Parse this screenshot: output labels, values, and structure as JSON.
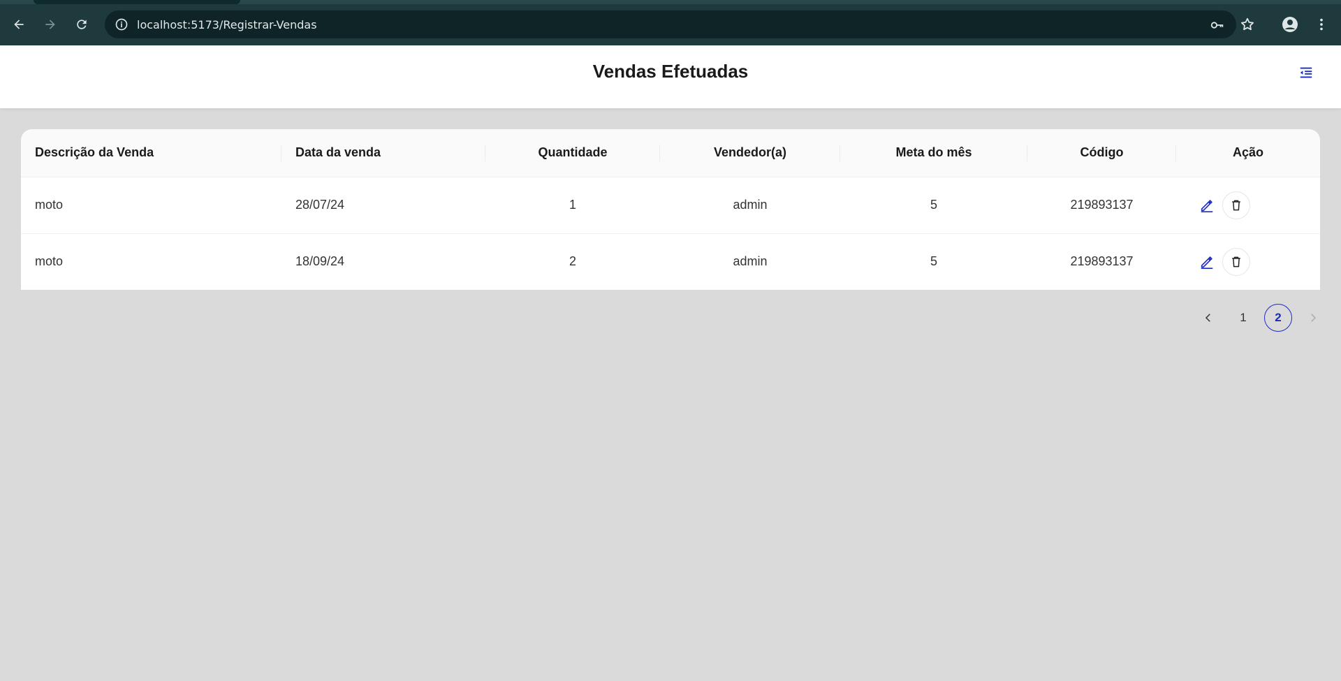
{
  "browser": {
    "url": "localhost:5173/Registrar-Vendas"
  },
  "header": {
    "title": "Vendas Efetuadas"
  },
  "table": {
    "columns": [
      "Descrição da Venda",
      "Data da venda",
      "Quantidade",
      "Vendedor(a)",
      "Meta do mês",
      "Código",
      "Ação"
    ],
    "rows": [
      {
        "descricao": "moto",
        "data": "28/07/24",
        "quantidade": "1",
        "vendedor": "admin",
        "meta": "5",
        "codigo": "219893137"
      },
      {
        "descricao": "moto",
        "data": "18/09/24",
        "quantidade": "2",
        "vendedor": "admin",
        "meta": "5",
        "codigo": "219893137"
      }
    ]
  },
  "pagination": {
    "pages": [
      "1",
      "2"
    ],
    "current": "2"
  },
  "colors": {
    "accent": "#1a2bc4",
    "chrome": "#1e3a3d",
    "background": "#dadada"
  }
}
